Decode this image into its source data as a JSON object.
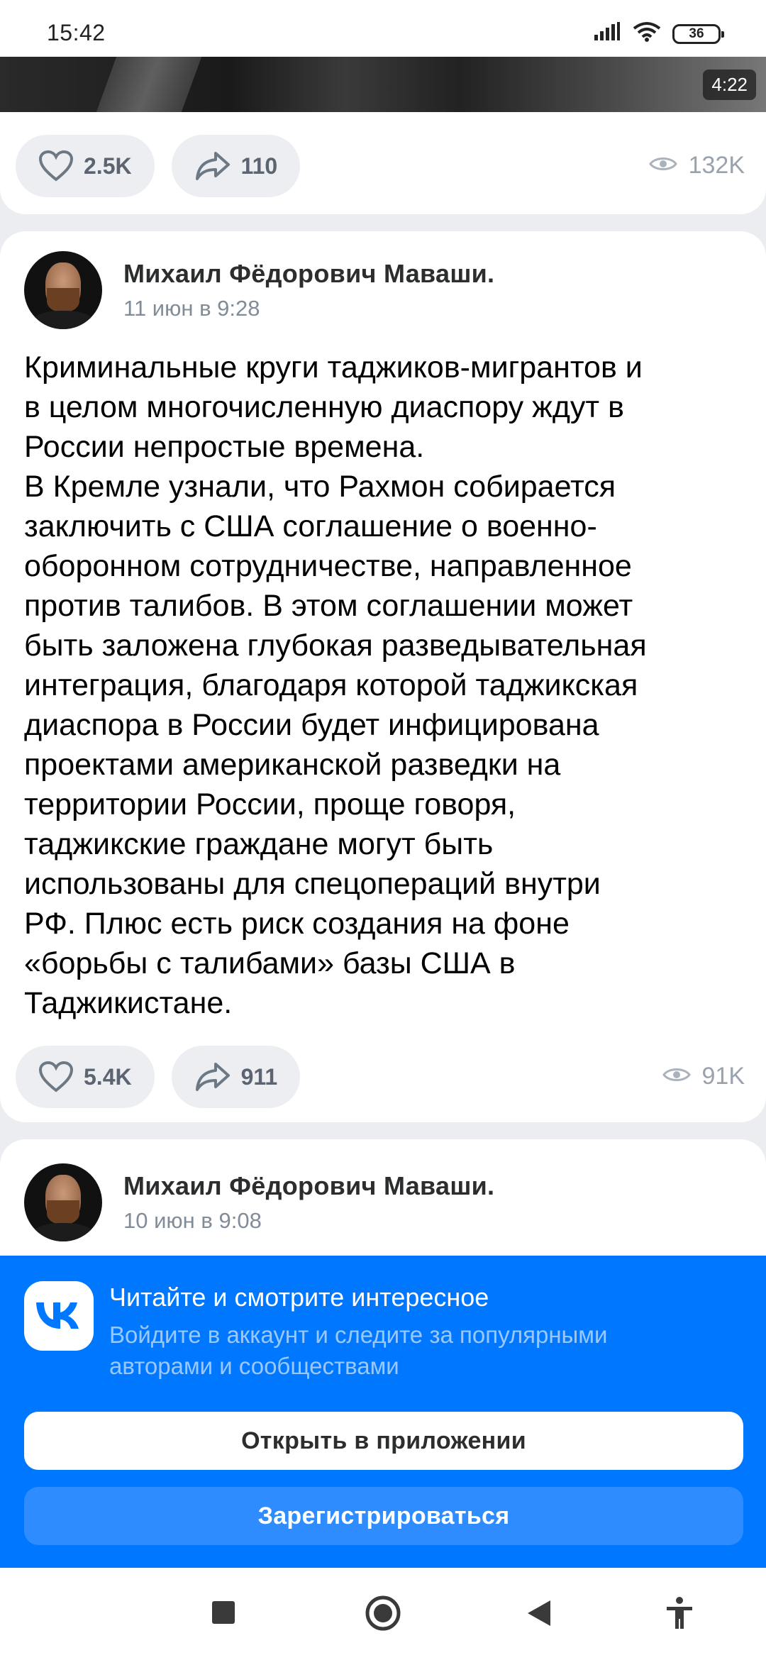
{
  "status_bar": {
    "time": "15:42",
    "battery": "36"
  },
  "post_previous": {
    "video_duration": "4:22",
    "likes": "2.5K",
    "shares": "110",
    "views": "132K"
  },
  "post_main": {
    "author": "Михаил Фёдорович Маваши.",
    "date": "11 июн в 9:28",
    "text": "Криминальные круги таджиков-мигрантов и\nв целом многочисленную диаспору ждут в\nРоссии непростые времена.\nВ Кремле узнали, что Рахмон собирается\nзаключить с США соглашение о военно-\nоборонном сотрудничестве, направленное\nпротив талибов. В этом соглашении может\nбыть заложена глубокая разведывательная\nинтеграция, благодаря которой таджикская\nдиаспора в России будет инфицирована\nпроектами американской разведки на\nтерритории России, проще говоря,\nтаджикские граждане могут быть\nиспользованы для спецопераций внутри\nРФ. Плюс есть риск создания на фоне\n«борьбы с талибами» базы США в\nТаджикистане.",
    "likes": "5.4K",
    "shares": "911",
    "views": "91K"
  },
  "post_next": {
    "author": "Михаил Фёдорович Маваши.",
    "date": "10 июн в 9:08"
  },
  "login_banner": {
    "title": "Читайте и смотрите интересное",
    "subtitle": "Войдите в аккаунт и следите за популярными авторами и сообществами",
    "open_app_label": "Открыть в приложении",
    "register_label": "Зарегистрироваться"
  },
  "colors": {
    "vk_blue": "#0077ff",
    "pill_bg": "#eceef1",
    "secondary_text": "#818c99"
  },
  "icons": [
    "signal-icon",
    "wifi-icon",
    "heart-icon",
    "share-icon",
    "eye-icon",
    "vk-logo-icon",
    "recents-icon",
    "home-icon",
    "back-icon",
    "accessibility-icon"
  ]
}
